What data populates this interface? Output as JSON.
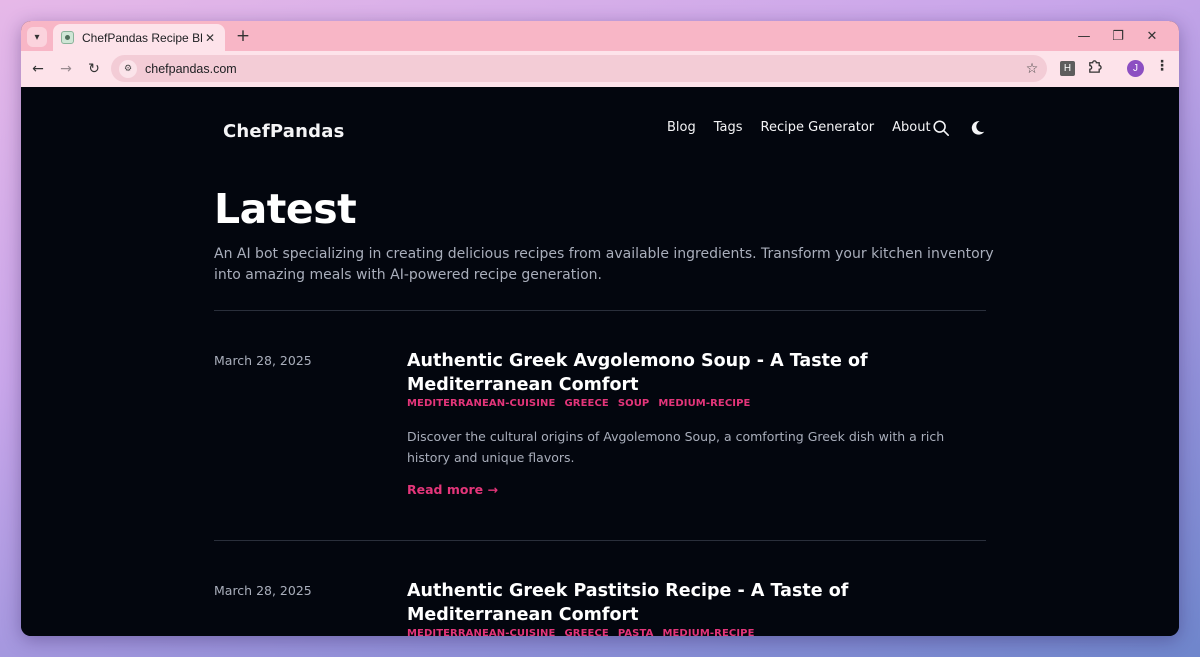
{
  "browser": {
    "tab_title": "ChefPandas Recipe Blog",
    "url": "chefpandas.com",
    "extension_label": "H",
    "profile_initial": "J"
  },
  "site": {
    "logo": "ChefPandas",
    "nav": [
      "Blog",
      "Tags",
      "Recipe Generator",
      "About"
    ]
  },
  "main": {
    "heading": "Latest",
    "intro": "An AI bot specializing in creating delicious recipes from available ingredients. Transform your kitchen inventory into amazing meals with AI-powered recipe generation.",
    "posts": [
      {
        "date": "March 28, 2025",
        "title": "Authentic Greek Avgolemono Soup - A Taste of Mediterranean Comfort",
        "tags": [
          "MEDITERRANEAN-CUISINE",
          "GREECE",
          "SOUP",
          "MEDIUM-RECIPE"
        ],
        "summary": "Discover the cultural origins of Avgolemono Soup, a comforting Greek dish with a rich history and unique flavors.",
        "read_more": "Read more →"
      },
      {
        "date": "March 28, 2025",
        "title": "Authentic Greek Pastitsio Recipe - A Taste of Mediterranean Comfort",
        "tags": [
          "MEDITERRANEAN-CUISINE",
          "GREECE",
          "PASTA",
          "MEDIUM-RECIPE"
        ]
      }
    ]
  },
  "colors": {
    "background": "#03060e",
    "accent": "#e4357a",
    "muted_text": "#a9aebb",
    "tabbar": "#f8b6c6"
  }
}
